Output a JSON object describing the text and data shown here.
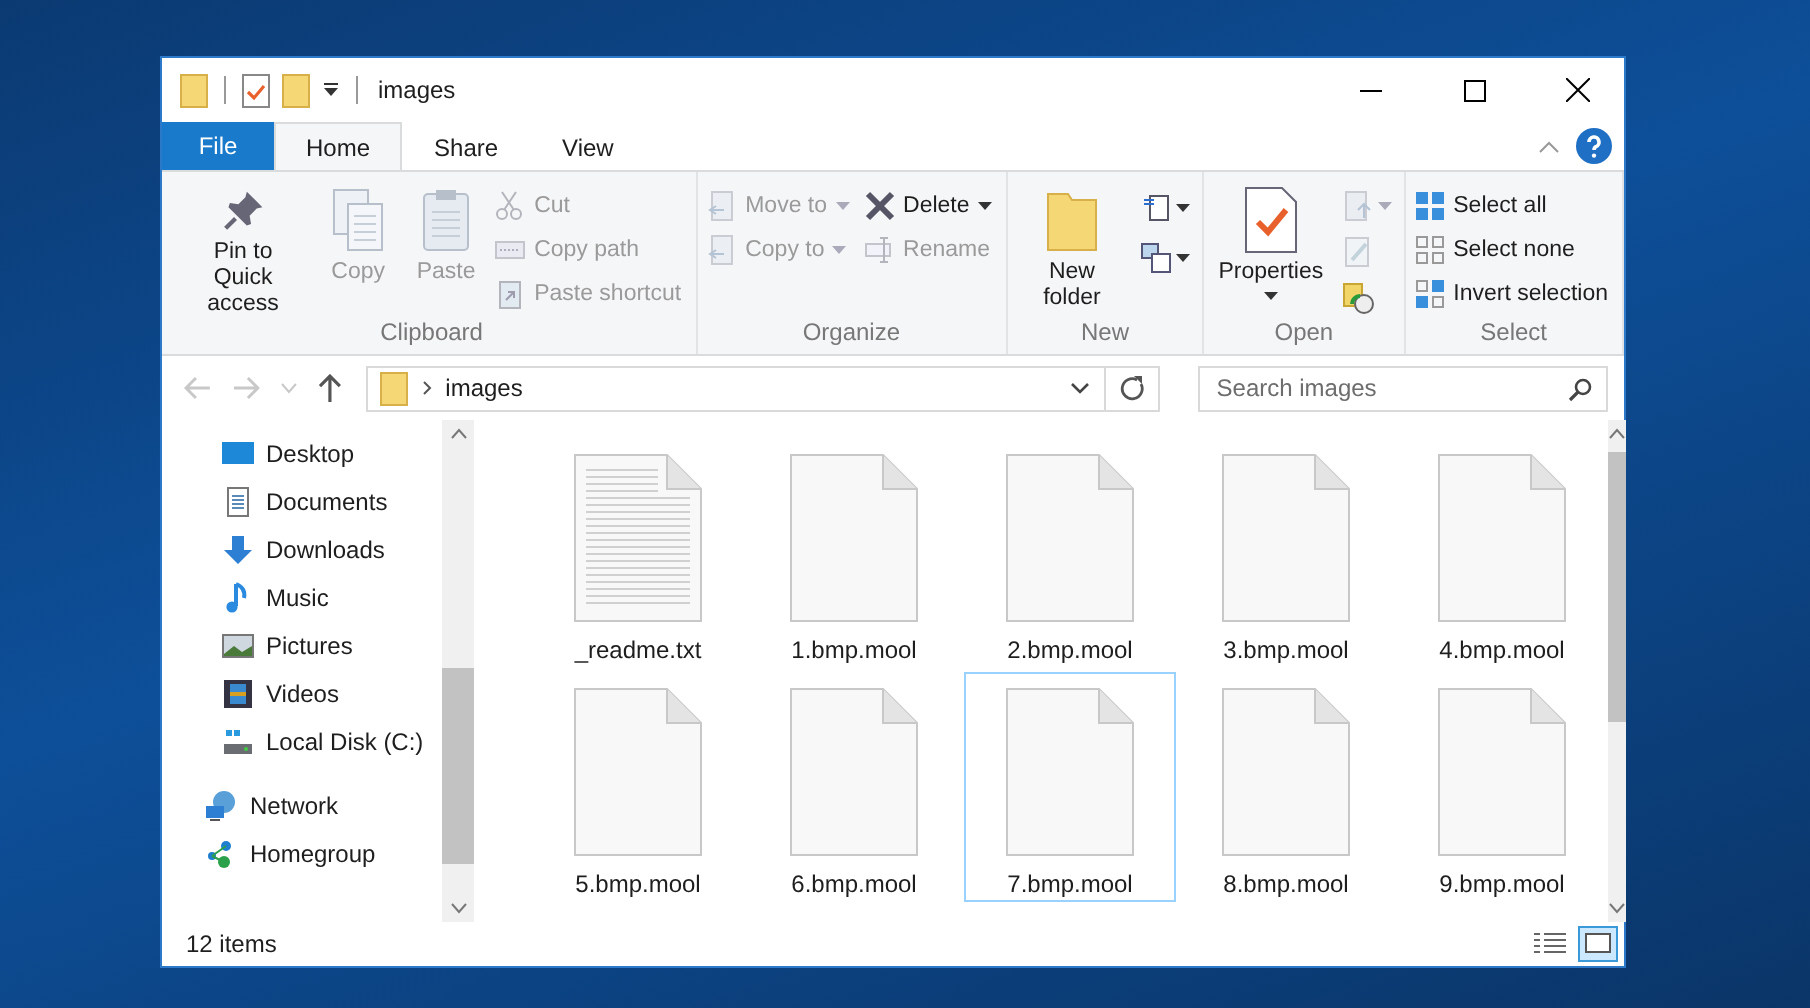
{
  "window": {
    "title": "images"
  },
  "tabs": [
    {
      "label": "File",
      "kind": "file",
      "selected": false
    },
    {
      "label": "Home",
      "kind": "tab",
      "selected": true
    },
    {
      "label": "Share",
      "kind": "tab",
      "selected": false
    },
    {
      "label": "View",
      "kind": "tab",
      "selected": false
    }
  ],
  "ribbon": [
    {
      "label": "Clipboard",
      "items": [
        {
          "kind": "large",
          "label": "Pin to Quick access",
          "disabled": false,
          "menu": false
        },
        {
          "kind": "large",
          "label": "Copy",
          "disabled": true,
          "menu": false
        },
        {
          "kind": "large",
          "label": "Paste",
          "disabled": true,
          "menu": false
        },
        {
          "kind": "column",
          "entries": [
            {
              "label": "Cut",
              "disabled": true,
              "menu": false
            },
            {
              "label": "Copy path",
              "disabled": true,
              "menu": false
            },
            {
              "label": "Paste shortcut",
              "disabled": true,
              "menu": false
            }
          ]
        }
      ]
    },
    {
      "label": "Organize",
      "items": [
        {
          "kind": "column",
          "entries": [
            {
              "label": "Move to",
              "disabled": true,
              "menu": true
            },
            {
              "label": "Copy to",
              "disabled": true,
              "menu": true
            }
          ]
        },
        {
          "kind": "column",
          "entries": [
            {
              "label": "Delete",
              "disabled": false,
              "menu": true
            },
            {
              "label": "Rename",
              "disabled": true,
              "menu": false
            }
          ]
        }
      ]
    },
    {
      "label": "New",
      "items": [
        {
          "kind": "large",
          "label": "New folder",
          "disabled": false,
          "menu": false
        },
        {
          "kind": "iconcolumn",
          "entries": [
            {
              "disabled": false,
              "menu": true
            },
            {
              "disabled": false,
              "menu": true
            }
          ]
        }
      ]
    },
    {
      "label": "Open",
      "items": [
        {
          "kind": "large",
          "label": "Properties",
          "disabled": false,
          "menu": true
        },
        {
          "kind": "iconcolumn",
          "entries": [
            {
              "disabled": true,
              "menu": true
            },
            {
              "disabled": true,
              "menu": false
            },
            {
              "disabled": false,
              "menu": false
            }
          ]
        }
      ]
    },
    {
      "label": "Select",
      "items": [
        {
          "kind": "column",
          "entries": [
            {
              "label": "Select all",
              "disabled": false,
              "menu": false
            },
            {
              "label": "Select none",
              "disabled": false,
              "menu": false
            },
            {
              "label": "Invert selection",
              "disabled": false,
              "menu": false
            }
          ]
        }
      ]
    }
  ],
  "address": {
    "path": "images",
    "search_placeholder": "Search images"
  },
  "navigation": {
    "this_pc_items": [
      {
        "label": "Desktop"
      },
      {
        "label": "Documents"
      },
      {
        "label": "Downloads"
      },
      {
        "label": "Music"
      },
      {
        "label": "Pictures"
      },
      {
        "label": "Videos"
      },
      {
        "label": "Local Disk (C:)"
      }
    ],
    "locations": [
      {
        "label": "Network"
      },
      {
        "label": "Homegroup"
      }
    ]
  },
  "files": [
    {
      "name": "_readme.txt",
      "kind": "text",
      "selected": false
    },
    {
      "name": "1.bmp.mool",
      "kind": "blank",
      "selected": false
    },
    {
      "name": "2.bmp.mool",
      "kind": "blank",
      "selected": false
    },
    {
      "name": "3.bmp.mool",
      "kind": "blank",
      "selected": false
    },
    {
      "name": "4.bmp.mool",
      "kind": "blank",
      "selected": false
    },
    {
      "name": "5.bmp.mool",
      "kind": "blank",
      "selected": false
    },
    {
      "name": "6.bmp.mool",
      "kind": "blank",
      "selected": false
    },
    {
      "name": "7.bmp.mool",
      "kind": "blank",
      "selected": true
    },
    {
      "name": "8.bmp.mool",
      "kind": "blank",
      "selected": false
    },
    {
      "name": "9.bmp.mool",
      "kind": "blank",
      "selected": false
    }
  ],
  "status_bar": {
    "item_count": "12 items"
  }
}
